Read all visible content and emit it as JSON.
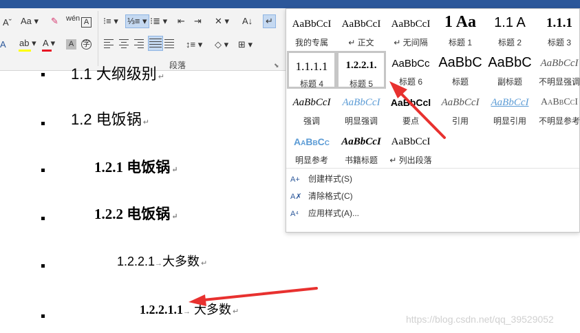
{
  "ribbon": {
    "group_label": "段落",
    "font_size_letter": "A",
    "change_case": "Aa",
    "phonetic": "wén",
    "border_char": "A",
    "char_shade": "A",
    "enclose_char": "字",
    "font_color_letter": "A",
    "highlight_letters": "ab",
    "sort_label": "A↓",
    "text_effect": "A"
  },
  "gallery": {
    "items": [
      {
        "preview": "AaBbCcI",
        "name": "我的专属",
        "style": "normal"
      },
      {
        "preview": "AaBbCcI",
        "name": "↵ 正文",
        "style": "normal"
      },
      {
        "preview": "AaBbCcI",
        "name": "↵ 无间隔",
        "style": "normal"
      },
      {
        "preview": "1 Aa",
        "name": "标题 1",
        "style": "h1"
      },
      {
        "preview": "1.1 A",
        "name": "标题 2",
        "style": "h2"
      },
      {
        "preview": "1.1.1",
        "name": "标题 3",
        "style": "h3"
      },
      {
        "preview": "1.1.1.1",
        "name": "标题 4",
        "style": "h4"
      },
      {
        "preview": "1.2.2.1.",
        "name": "标题 5",
        "style": "h5"
      },
      {
        "preview": "AaBbCc",
        "name": "标题 6",
        "style": "h6"
      },
      {
        "preview": "AaBbC",
        "name": "标题",
        "style": "title"
      },
      {
        "preview": "AaBbC",
        "name": "副标题",
        "style": "subtitle"
      },
      {
        "preview": "AaBbCcI",
        "name": "不明显强调",
        "style": "subtle-em"
      },
      {
        "preview": "AaBbCcI",
        "name": "强调",
        "style": "em"
      },
      {
        "preview": "AaBbCcI",
        "name": "明显强调",
        "style": "intense-em"
      },
      {
        "preview": "AaBbCcl",
        "name": "要点",
        "style": "strong"
      },
      {
        "preview": "AaBbCcI",
        "name": "引用",
        "style": "quote"
      },
      {
        "preview": "AaBbCcI",
        "name": "明显引用",
        "style": "intense-quote"
      },
      {
        "preview": "AaBbCcI",
        "name": "不明显参考",
        "style": "subtle-ref"
      },
      {
        "preview": "AaBbCc",
        "name": "明显参考",
        "style": "intense-ref"
      },
      {
        "preview": "AaBbCcI",
        "name": "书籍标题",
        "style": "book"
      },
      {
        "preview": "AaBbCcI",
        "name": "↵ 列出段落",
        "style": "normal"
      }
    ],
    "actions": [
      {
        "icon": "A+",
        "label": "创建样式(S)"
      },
      {
        "icon": "A✗",
        "label": "清除格式(C)"
      },
      {
        "icon": "A⁴",
        "label": "应用样式(A)..."
      }
    ]
  },
  "document": {
    "lines": [
      {
        "number": "1.1",
        "text": "大纲级别",
        "style": "h2-partial"
      },
      {
        "number": "1.2",
        "text": "电饭锅",
        "style": "h2"
      },
      {
        "number": "1.2.1",
        "text": "电饭锅",
        "style": "h3"
      },
      {
        "number": "1.2.2",
        "text": "电饭锅",
        "style": "h3"
      },
      {
        "number": "1.2.2.1",
        "text": "大多数",
        "style": "h4"
      },
      {
        "number": "1.2.2.1.1",
        "text": "大多数",
        "style": "h5"
      }
    ],
    "paragraph_mark": "↵",
    "tab_mark": "→"
  },
  "watermark": "https://blog.csdn.net/qq_39529052",
  "colors": {
    "accent": "#2b579a",
    "annotation_arrow": "#e8312f",
    "font_color_bar": "#e81123",
    "highlight_bar": "#ffff00"
  }
}
